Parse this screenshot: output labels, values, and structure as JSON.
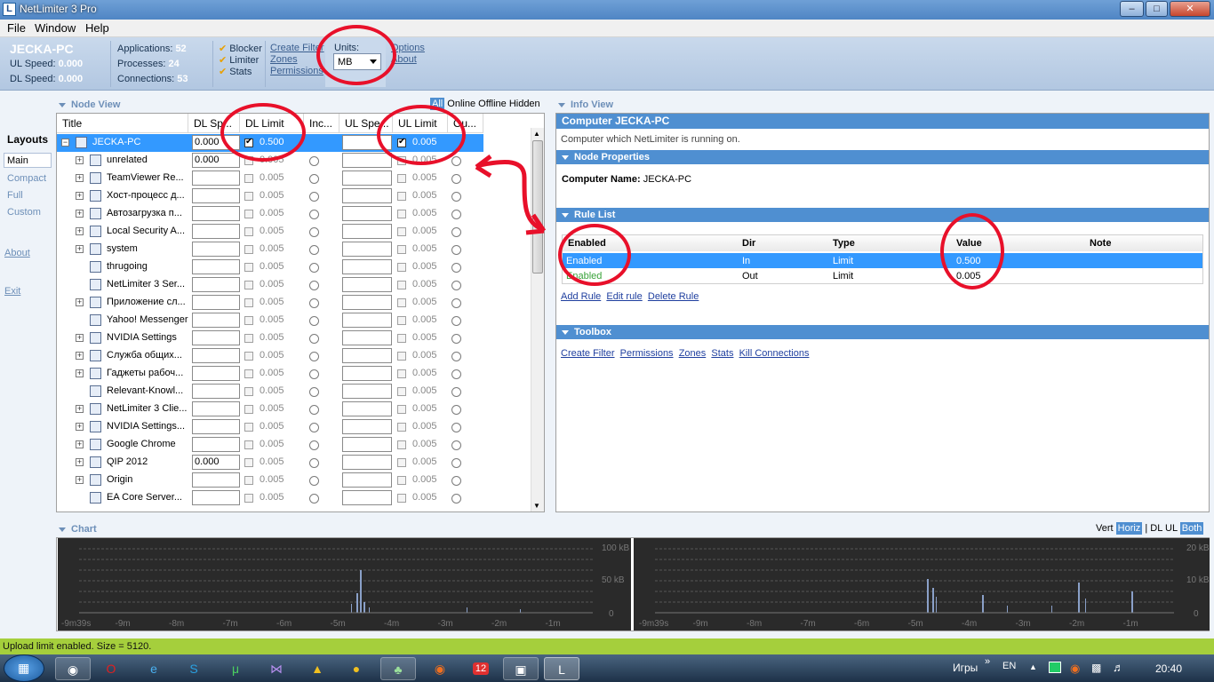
{
  "window": {
    "title": "NetLimiter 3 Pro",
    "icon": "netlimiter-icon"
  },
  "menu": [
    "File",
    "Window",
    "Help"
  ],
  "header": {
    "computer": "JECKA-PC",
    "ul_label": "UL Speed:",
    "ul_value": "0.000",
    "dl_label": "DL Speed:",
    "dl_value": "0.000",
    "apps_label": "Applications:",
    "apps_value": "52",
    "procs_label": "Processes:",
    "procs_value": "24",
    "conns_label": "Connections:",
    "conns_value": "53",
    "checks": [
      "Blocker",
      "Limiter",
      "Stats"
    ],
    "links1": [
      "Create Filter",
      "Zones",
      "Permissions"
    ],
    "units_label": "Units:",
    "units_value": "MB",
    "links2": [
      "Options",
      "About"
    ]
  },
  "layouts": {
    "title": "Layouts",
    "items": [
      "Main",
      "Compact",
      "Full",
      "Custom"
    ],
    "about": "About",
    "exit": "Exit"
  },
  "nodeview": {
    "title": "Node View",
    "filters": [
      "All",
      "Online",
      "Offline",
      "Hidden"
    ],
    "columns": [
      "Title",
      "DL Sp...",
      "DL Limit",
      "Inc...",
      "UL Spe...",
      "UL Limit",
      "Ou..."
    ],
    "rows": [
      {
        "name": "JECKA-PC",
        "dls": "0.000",
        "dlv": "0.500",
        "ulv": "0.005",
        "exp": "−"
      },
      {
        "name": "unrelated",
        "dls": "0.000",
        "dlv": "0.005",
        "ulv": "0.005",
        "exp": "+"
      },
      {
        "name": "TeamViewer Re...",
        "dls": "",
        "dlv": "0.005",
        "ulv": "0.005",
        "exp": "+"
      },
      {
        "name": "Хост-процесс д...",
        "dls": "",
        "dlv": "0.005",
        "ulv": "0.005",
        "exp": "+"
      },
      {
        "name": "Автозагрузка п...",
        "dls": "",
        "dlv": "0.005",
        "ulv": "0.005",
        "exp": "+"
      },
      {
        "name": "Local Security A...",
        "dls": "",
        "dlv": "0.005",
        "ulv": "0.005",
        "exp": "+"
      },
      {
        "name": "system",
        "dls": "",
        "dlv": "0.005",
        "ulv": "0.005",
        "exp": "+"
      },
      {
        "name": "thrugoing",
        "dls": "",
        "dlv": "0.005",
        "ulv": "0.005",
        "exp": ""
      },
      {
        "name": "NetLimiter 3 Ser...",
        "dls": "",
        "dlv": "0.005",
        "ulv": "0.005",
        "exp": ""
      },
      {
        "name": "Приложение сл...",
        "dls": "",
        "dlv": "0.005",
        "ulv": "0.005",
        "exp": "+"
      },
      {
        "name": "Yahoo! Messenger",
        "dls": "",
        "dlv": "0.005",
        "ulv": "0.005",
        "exp": ""
      },
      {
        "name": "NVIDIA Settings",
        "dls": "",
        "dlv": "0.005",
        "ulv": "0.005",
        "exp": "+"
      },
      {
        "name": "Служба общих...",
        "dls": "",
        "dlv": "0.005",
        "ulv": "0.005",
        "exp": "+"
      },
      {
        "name": "Гаджеты рабоч...",
        "dls": "",
        "dlv": "0.005",
        "ulv": "0.005",
        "exp": "+"
      },
      {
        "name": "Relevant-Knowl...",
        "dls": "",
        "dlv": "0.005",
        "ulv": "0.005",
        "exp": ""
      },
      {
        "name": "NetLimiter 3 Clie...",
        "dls": "",
        "dlv": "0.005",
        "ulv": "0.005",
        "exp": "+"
      },
      {
        "name": "NVIDIA Settings...",
        "dls": "",
        "dlv": "0.005",
        "ulv": "0.005",
        "exp": "+"
      },
      {
        "name": "Google Chrome",
        "dls": "",
        "dlv": "0.005",
        "ulv": "0.005",
        "exp": "+"
      },
      {
        "name": "QIP 2012",
        "dls": "0.000",
        "dlv": "0.005",
        "ulv": "0.005",
        "exp": "+"
      },
      {
        "name": "Origin",
        "dls": "",
        "dlv": "0.005",
        "ulv": "0.005",
        "exp": "+"
      },
      {
        "name": "EA Core Server...",
        "dls": "",
        "dlv": "0.005",
        "ulv": "0.005",
        "exp": ""
      }
    ]
  },
  "infoview": {
    "title": "Info View",
    "computer_bar": "Computer JECKA-PC",
    "computer_desc": "Computer which NetLimiter is running on.",
    "node_props": "Node Properties",
    "cn_label": "Computer Name:",
    "cn_value": "JECKA-PC",
    "rule_list": "Rule List",
    "rule_cols": [
      "Enabled",
      "Dir",
      "Type",
      "Value",
      "Note"
    ],
    "rules": [
      {
        "enabled": "Enabled",
        "dir": "In",
        "type": "Limit",
        "value": "0.500",
        "note": ""
      },
      {
        "enabled": "Enabled",
        "dir": "Out",
        "type": "Limit",
        "value": "0.005",
        "note": ""
      }
    ],
    "rule_links": [
      "Add Rule",
      "Edit rule",
      "Delete Rule"
    ],
    "toolbox": "Toolbox",
    "toolbox_links": [
      "Create Filter",
      "Permissions",
      "Zones",
      "Stats",
      "Kill Connections"
    ]
  },
  "chart": {
    "title": "Chart",
    "opts": [
      "Vert",
      "Horiz",
      "|",
      "DL",
      "UL",
      "Both"
    ],
    "left_y": [
      "100 kB",
      "50 kB",
      "0"
    ],
    "right_y": [
      "20 kB",
      "10 kB",
      "0"
    ],
    "x": [
      "-9m39s",
      "-9m",
      "-8m",
      "-7m",
      "-6m",
      "-5m",
      "-4m",
      "-3m",
      "-2m",
      "-1m"
    ]
  },
  "status": "Upload limit enabled. Size = 5120.",
  "tray": {
    "lang1": "Игры",
    "lang2": "EN",
    "time": "20:40",
    "badge": "12"
  },
  "colors": {
    "accent": "#4f8fd1",
    "selection": "#3399ff",
    "status": "#a5cf3c",
    "annotation": "#e8102a"
  }
}
